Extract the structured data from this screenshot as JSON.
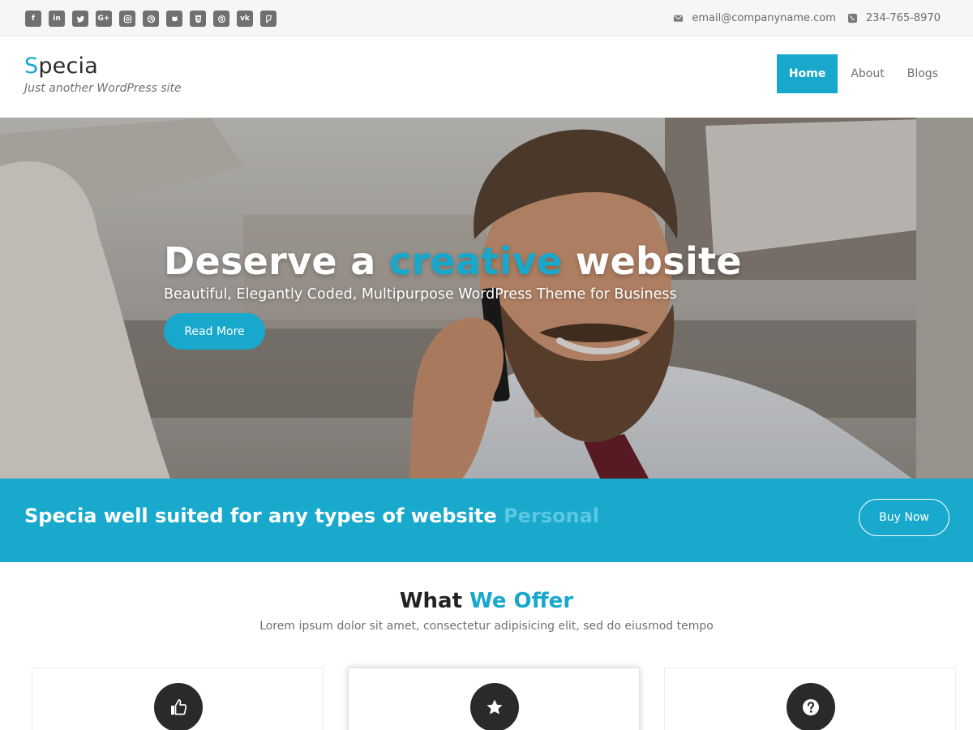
{
  "topbar": {
    "social_icons": [
      "facebook-icon",
      "linkedin-icon",
      "twitter-icon",
      "google-plus-icon",
      "instagram-icon",
      "dribbble-icon",
      "github-icon",
      "html5-icon",
      "skype-icon",
      "vk-icon",
      "foursquare-icon"
    ],
    "email": "email@companyname.com",
    "phone": "234-765-8970"
  },
  "header": {
    "brand_first": "S",
    "brand_rest": "pecia",
    "tagline": "Just another WordPress site",
    "nav": [
      {
        "label": "Home",
        "active": true
      },
      {
        "label": "About",
        "active": false
      },
      {
        "label": "Blogs",
        "active": false
      }
    ]
  },
  "hero": {
    "title_before": "Deserve a ",
    "title_highlight": "creative",
    "title_after": " website",
    "subtitle": "Beautiful, Elegantly Coded, Multipurpose WordPress Theme for Business",
    "button": "Read More"
  },
  "cta": {
    "text": "Specia well suited for any types of website ",
    "highlight": "Personal",
    "button": "Buy Now"
  },
  "offer": {
    "title_before": "What ",
    "title_highlight": "We Offer",
    "subtitle": "Lorem ipsum dolor sit amet, consectetur adipisicing elit, sed do eiusmod tempo",
    "cards": [
      {
        "icon": "thumbs-up-icon"
      },
      {
        "icon": "star-icon"
      },
      {
        "icon": "question-icon"
      }
    ]
  },
  "colors": {
    "accent": "#17a8cc",
    "cta_band": "#18a9cd",
    "icon_circle": "#2a2a2a"
  }
}
